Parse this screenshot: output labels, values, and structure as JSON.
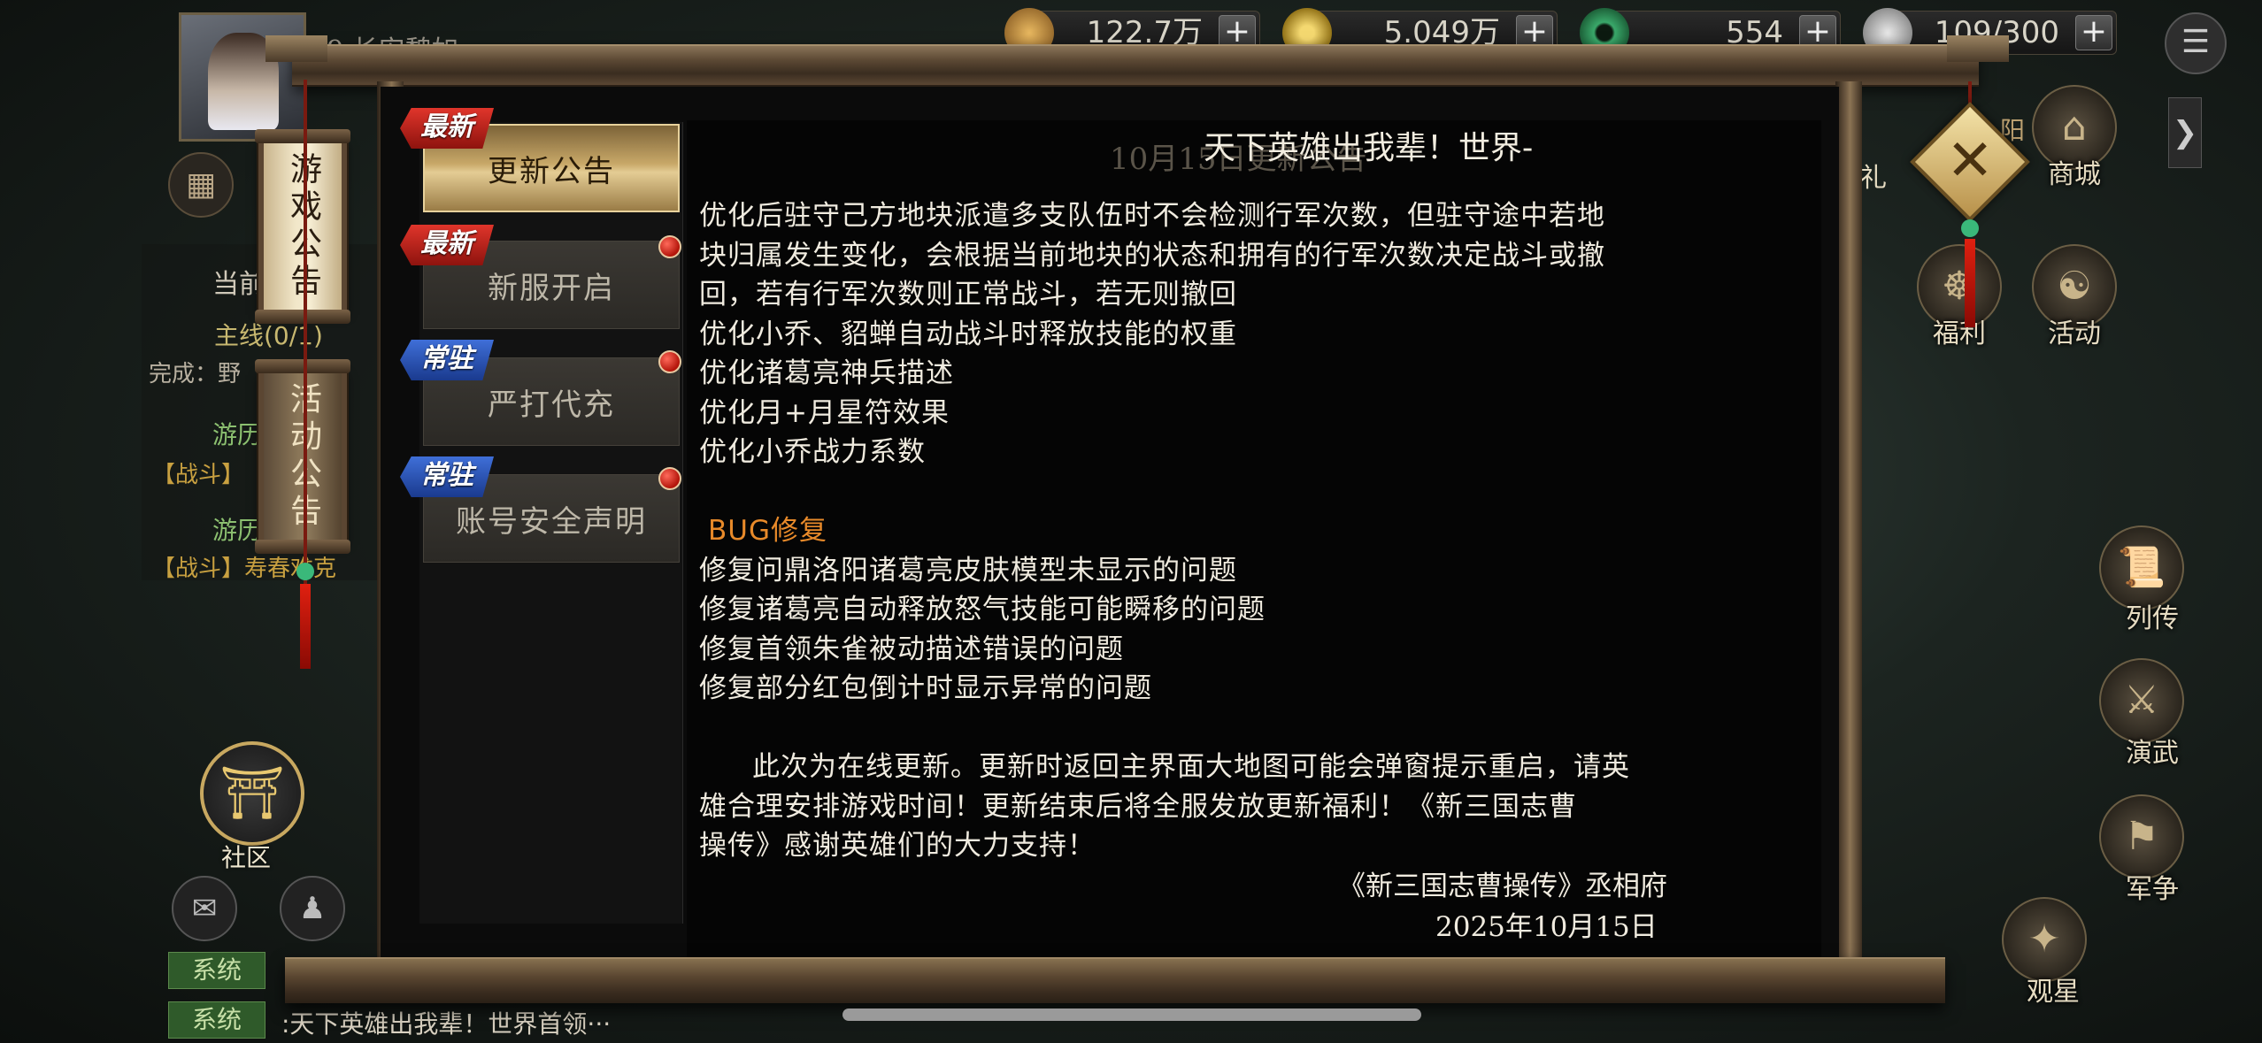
{
  "player": {
    "name": "99 长安魏如"
  },
  "resources": [
    {
      "name": "copper",
      "value": "122.7万",
      "icon": "copper-coin-icon",
      "color": "#c89a3a"
    },
    {
      "name": "gold",
      "value": "5.049万",
      "icon": "gold-coin-icon",
      "color": "#d6b43a"
    },
    {
      "name": "jade",
      "value": "554",
      "icon": "jade-icon",
      "color": "#3aa86a"
    },
    {
      "name": "stamina",
      "value": "109/300",
      "icon": "stamina-icon",
      "color": "#bdbdbd"
    }
  ],
  "left_vertical_tabs": [
    {
      "label": "游戏公告",
      "active": true
    },
    {
      "label": "活动公告",
      "active": false
    }
  ],
  "announcement_tabs": [
    {
      "label": "更新公告",
      "badge": "最新",
      "badge_color": "red",
      "active": true,
      "red_dot": false
    },
    {
      "label": "新服开启",
      "badge": "最新",
      "badge_color": "red",
      "active": false,
      "red_dot": true
    },
    {
      "label": "严打代充",
      "badge": "常驻",
      "badge_color": "blue",
      "active": false,
      "red_dot": true
    },
    {
      "label": "账号安全声明",
      "badge": "常驻",
      "badge_color": "blue",
      "active": false,
      "red_dot": true
    }
  ],
  "content": {
    "title": "天下英雄出我辈！世界-",
    "ghost_header": "10月15日更新公告",
    "lines": [
      "优化后驻守己方地块派遣多支队伍时不会检测行军次数，但驻守途中若地",
      "块归属发生变化，会根据当前地块的状态和拥有的行军次数决定战斗或撤",
      "回，若有行军次数则正常战斗，若无则撤回",
      "优化小乔、貂蝉自动战斗时释放技能的权重",
      "优化诸葛亮神兵描述",
      "优化月+月星符效果",
      "优化小乔战力系数"
    ],
    "bug_heading": "BUG修复",
    "bug_lines": [
      "修复问鼎洛阳诸葛亮皮肤模型未显示的问题",
      "修复诸葛亮自动释放怒气技能可能瞬移的问题",
      "修复首领朱雀被动描述错误的问题",
      "修复部分红包倒计时显示异常的问题"
    ],
    "closing_lines": [
      "此次为在线更新。更新时返回主界面大地图可能会弹窗提示重启，请英",
      "雄合理安排游戏时间！更新结束后将全服发放更新福利！《新三国志曹",
      "操传》感谢英雄们的大力支持！"
    ],
    "signature": "《新三国志曹操传》丞相府",
    "date": "2025年10月15日"
  },
  "right_menu": [
    {
      "label": "商城",
      "icon": "shop-icon"
    },
    {
      "label": "福利",
      "icon": "welfare-icon"
    },
    {
      "label": "活动",
      "icon": "activity-icon"
    },
    {
      "label": "列传",
      "icon": "biography-scroll-icon"
    },
    {
      "label": "演武",
      "icon": "crossed-swords-icon"
    },
    {
      "label": "军争",
      "icon": "war-icon"
    },
    {
      "label": "观星",
      "icon": "stargazing-icon"
    }
  ],
  "right_partial": {
    "gift_label": "礼",
    "yang_label": "阳"
  },
  "left_hud": {
    "quest_header": "当前",
    "quest_main": "主线(0/1)",
    "quest_done": "完成：野",
    "quest_item1": "游历",
    "quest_item1_sub": "【战斗】",
    "quest_item2": "游历",
    "quest_item2_sub": "【战斗】寿春难克",
    "community_label": "社区"
  },
  "chat": [
    {
      "tag": "系统",
      "text": ""
    },
    {
      "tag": "系统",
      "text": ":天下英雄出我辈！世界首领···"
    }
  ]
}
